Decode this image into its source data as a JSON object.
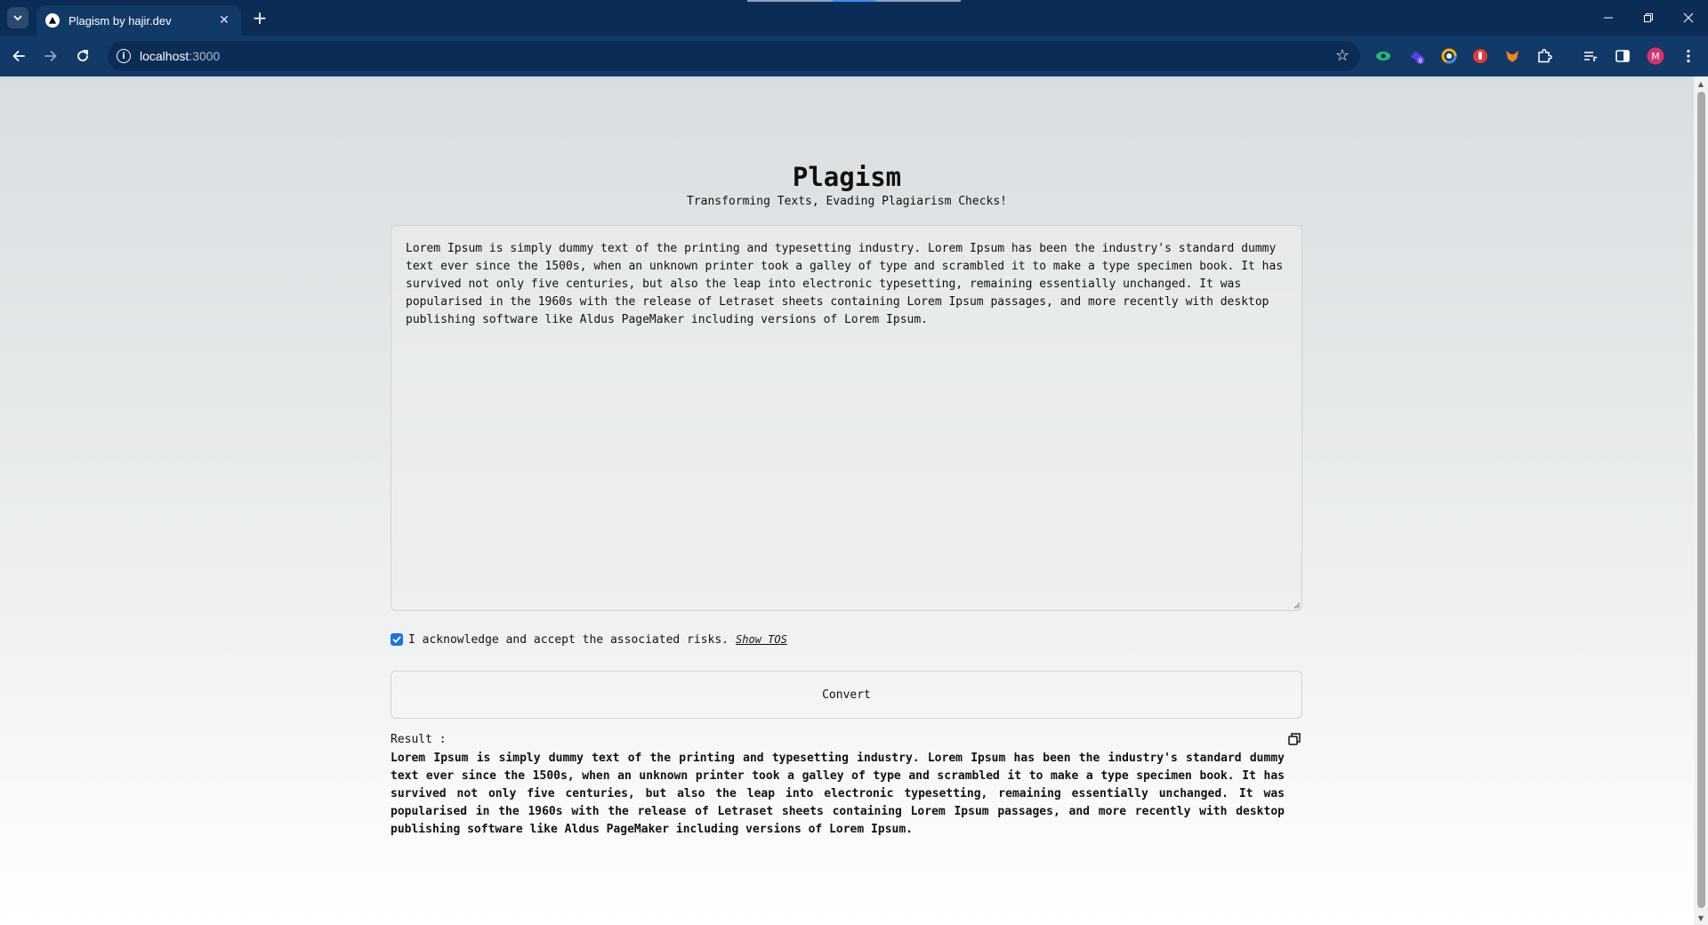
{
  "browser": {
    "tab_title": "Plagism by hajir.dev",
    "url_host": "localhost",
    "url_port": ":3000",
    "profile_initial": "M",
    "extension_badge": "8"
  },
  "page": {
    "title": "Plagism",
    "subtitle": "Transforming Texts, Evading Plagiarism Checks!",
    "input_text": "Lorem Ipsum is simply dummy text of the printing and typesetting industry. Lorem Ipsum has been the industry's standard dummy text ever since the 1500s, when an unknown printer took a galley of type and scrambled it to make a type specimen book. It has survived not only five centuries, but also the leap into electronic typesetting, remaining essentially unchanged. It was popularised in the 1960s with the release of Letraset sheets containing Lorem Ipsum passages, and more recently with desktop publishing software like Aldus PageMaker including versions of Lorem Ipsum.",
    "ack_label": "I acknowledge and accept the associated risks.",
    "ack_checked": true,
    "show_tos": "Show TOS",
    "convert_label": "Convert",
    "result_label": "Result :",
    "result_text": "Lorem Ipsum is simply dummy text of the printing and typesetting industry. Lorem Ipsum has been the industry's standard dummy text ever since the 1500s, when an unknown printer took a galley of type and scrambled it to make a type specimen book. It has survived not only five centuries, but also the leap into electronic typesetting, remaining essentially unchanged. It was popularised in the 1960s with the release of Letraset sheets containing Lorem Ipsum passages, and more recently with desktop publishing software like Aldus PageMaker including versions of Lorem Ipsum."
  },
  "colors": {
    "chrome_dark": "#0b2d55",
    "chrome_toolbar": "#123a68",
    "checkbox_blue": "#1a73e8",
    "text": "#111111"
  },
  "icons": {
    "tab_list": "chevron-down-icon",
    "favicon": "triangle-logo-icon",
    "tab_close": "close-icon",
    "new_tab": "plus-icon",
    "back": "arrow-left-icon",
    "forward": "arrow-right-icon",
    "reload": "reload-icon",
    "site_info": "info-icon",
    "bookmark": "star-icon",
    "copy": "copy-icon"
  }
}
